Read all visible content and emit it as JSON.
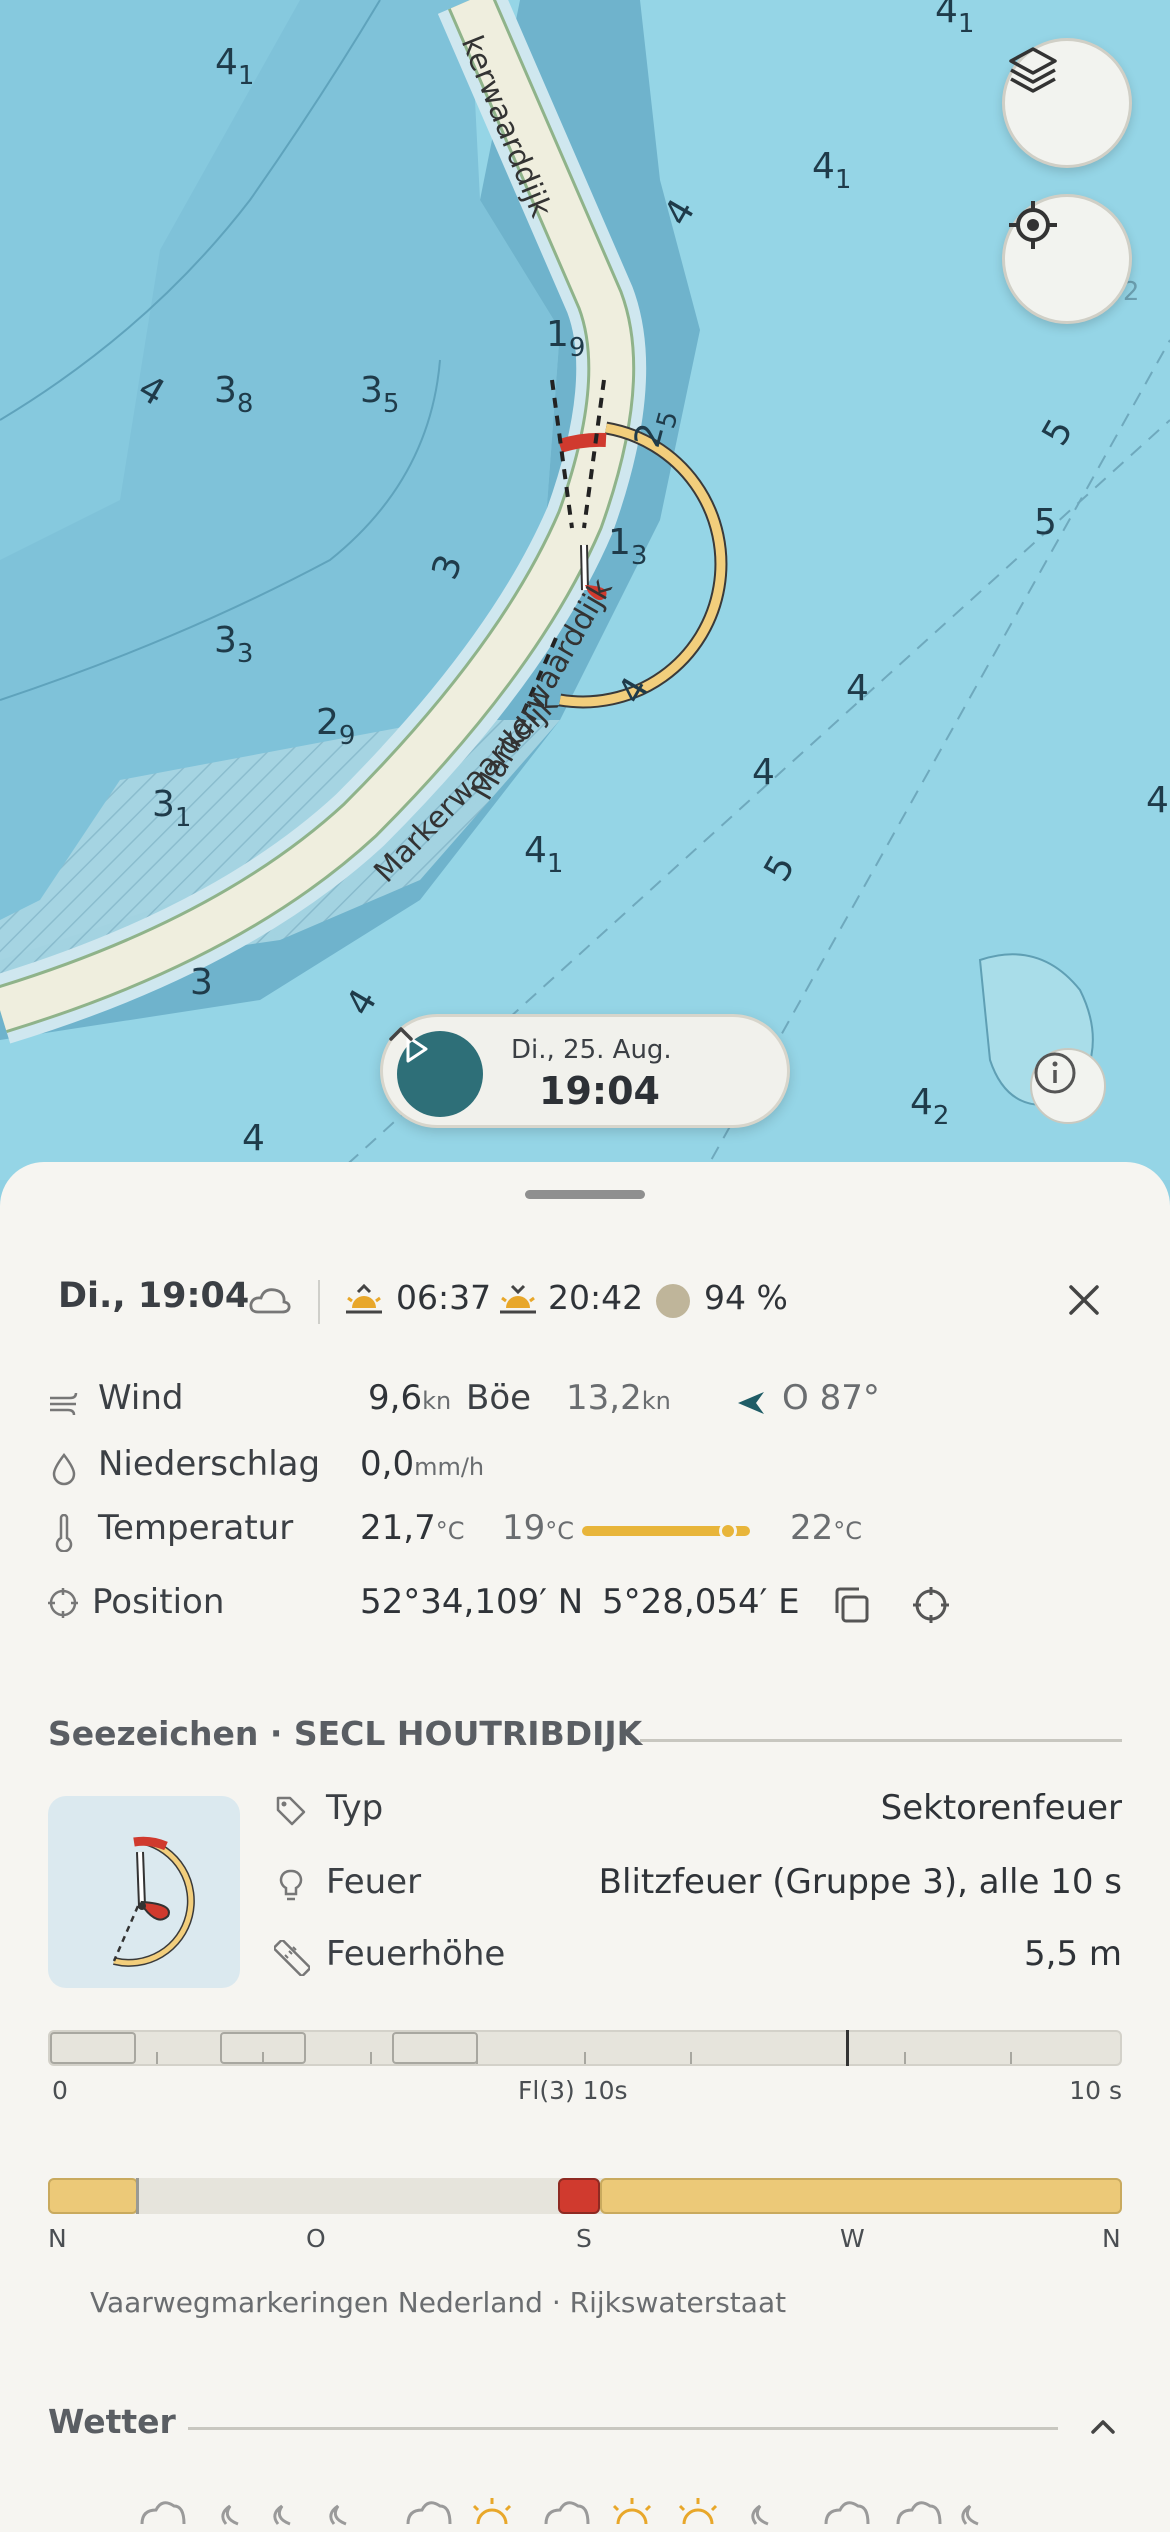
{
  "map": {
    "depths": [
      {
        "main": "4",
        "sub": "1"
      },
      {
        "main": "4",
        "sub": "1"
      },
      {
        "main": "4",
        "sub": "1"
      },
      {
        "main": "4",
        "sub": ""
      },
      {
        "main": "1",
        "sub": "9"
      },
      {
        "main": "4",
        "sub": ""
      },
      {
        "main": "3",
        "sub": "8"
      },
      {
        "main": "3",
        "sub": "5"
      },
      {
        "main": "2",
        "sub": "5"
      },
      {
        "main": "5",
        "sub": ""
      },
      {
        "main": "5",
        "sub": ""
      },
      {
        "main": "4",
        "sub": "2"
      },
      {
        "main": "1",
        "sub": "3"
      },
      {
        "main": "3",
        "sub": ""
      },
      {
        "main": "3",
        "sub": "3"
      },
      {
        "main": "4",
        "sub": ""
      },
      {
        "main": "4",
        "sub": ""
      },
      {
        "main": "2",
        "sub": "9"
      },
      {
        "main": "4",
        "sub": ""
      },
      {
        "main": "4",
        "sub": ""
      },
      {
        "main": "3",
        "sub": "1"
      },
      {
        "main": "4",
        "sub": "1"
      },
      {
        "main": "5",
        "sub": ""
      },
      {
        "main": "3",
        "sub": ""
      },
      {
        "main": "4",
        "sub": ""
      },
      {
        "main": "4",
        "sub": "2"
      },
      {
        "main": "4",
        "sub": ""
      }
    ],
    "road_labels": [
      "kerwaarddijk",
      "Markerwaarddijk",
      "Markerwaarddijk"
    ],
    "layers_icon": "layers-icon",
    "locate_icon": "crosshair-icon",
    "info_icon": "info-icon"
  },
  "timebar": {
    "date": "Di., 25. Aug.",
    "time": "19:04",
    "accent": "#2e6f78"
  },
  "summary": {
    "datetime": "Di., 19:04",
    "sunrise": "06:37",
    "sunset": "20:42",
    "moon": "94 %"
  },
  "weather_rows": {
    "wind": {
      "label": "Wind",
      "speed": "9,6",
      "unit": "kn",
      "gust_label": "Böe",
      "gust": "13,2",
      "gust_unit": "kn",
      "direction": "O 87°"
    },
    "precip": {
      "label": "Niederschlag",
      "value": "0,0",
      "unit": "mm/h"
    },
    "temp": {
      "label": "Temperatur",
      "value": "21,7",
      "unit": "°C",
      "min": "19",
      "max": "22",
      "min_unit": "°C",
      "max_unit": "°C",
      "current_fraction": 0.87
    },
    "position": {
      "label": "Position",
      "lat": "52°34,109′ N",
      "lon": "5°28,054′ E"
    }
  },
  "seamark": {
    "title": "Seezeichen · SECL HOUTRIBDIJK",
    "rows": [
      {
        "icon": "tag-icon",
        "label": "Typ",
        "value": "Sektorenfeuer"
      },
      {
        "icon": "bulb-icon",
        "label": "Feuer",
        "value": "Blitzfeuer (Gruppe 3), alle 10 s"
      },
      {
        "icon": "ruler-icon",
        "label": "Feuerhöhe",
        "value": "5,5 m"
      }
    ],
    "period_axis": {
      "start": "0",
      "mid": "Fl(3) 10s",
      "end": "10 s"
    },
    "sector_axis": [
      "N",
      "O",
      "S",
      "W",
      "N"
    ],
    "source": "Vaarwegmarkeringen Nederland · Rijkswaterstaat",
    "colors": {
      "white": "#e6c87a",
      "red": "#d03a2e"
    }
  },
  "weather_section": {
    "title": "Wetter"
  }
}
